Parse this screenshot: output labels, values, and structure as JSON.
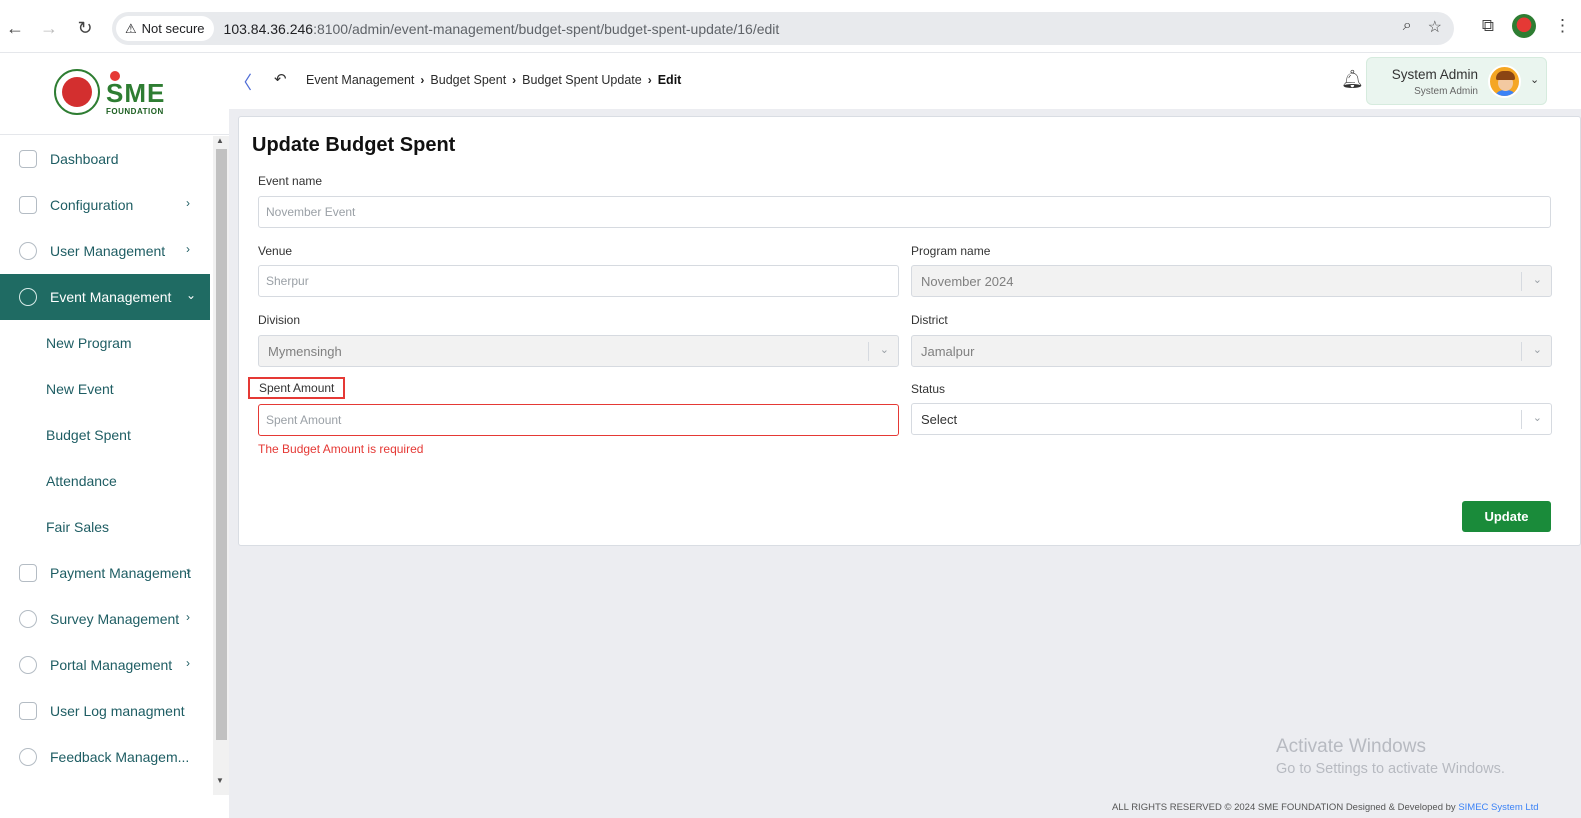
{
  "browser": {
    "not_secure_label": "Not secure",
    "url_host": "103.84.36.246",
    "url_rest": ":8100/admin/event-management/budget-spent/budget-spent-update/16/edit"
  },
  "logo": {
    "brand_text": "SME",
    "brand_sub": "FOUNDATION"
  },
  "sidebar": {
    "items": [
      {
        "label": "Dashboard"
      },
      {
        "label": "Configuration"
      },
      {
        "label": "User Management"
      },
      {
        "label": "Event Management"
      },
      {
        "label": "Payment Management"
      },
      {
        "label": "Survey Management"
      },
      {
        "label": "Portal Management"
      },
      {
        "label": "User Log managment"
      },
      {
        "label": "Feedback Managem..."
      }
    ],
    "event_sub_items": [
      {
        "label": "New Program"
      },
      {
        "label": "New Event"
      },
      {
        "label": "Budget Spent"
      },
      {
        "label": "Attendance"
      },
      {
        "label": "Fair Sales"
      }
    ]
  },
  "breadcrumb": {
    "items": [
      "Event Management",
      "Budget Spent",
      "Budget Spent Update"
    ],
    "current": "Edit"
  },
  "user": {
    "name": "System Admin",
    "role": "System Admin"
  },
  "form": {
    "title": "Update Budget Spent",
    "event_name": {
      "label": "Event name",
      "placeholder": "November Event"
    },
    "venue": {
      "label": "Venue",
      "placeholder": "Sherpur"
    },
    "program_name": {
      "label": "Program name",
      "value": "November 2024"
    },
    "division": {
      "label": "Division",
      "value": "Mymensingh"
    },
    "district": {
      "label": "District",
      "value": "Jamalpur"
    },
    "spent_amount": {
      "label": "Spent Amount",
      "placeholder": "Spent Amount",
      "error": "The Budget Amount is required"
    },
    "status": {
      "label": "Status",
      "value": "Select"
    },
    "update_label": "Update"
  },
  "watermark": {
    "line1": "Activate Windows",
    "line2": "Go to Settings to activate Windows."
  },
  "footer": {
    "text": "ALL RIGHTS RESERVED © 2024 SME FOUNDATION   Designed & Developed by",
    "link": "SIMEC System Ltd"
  }
}
